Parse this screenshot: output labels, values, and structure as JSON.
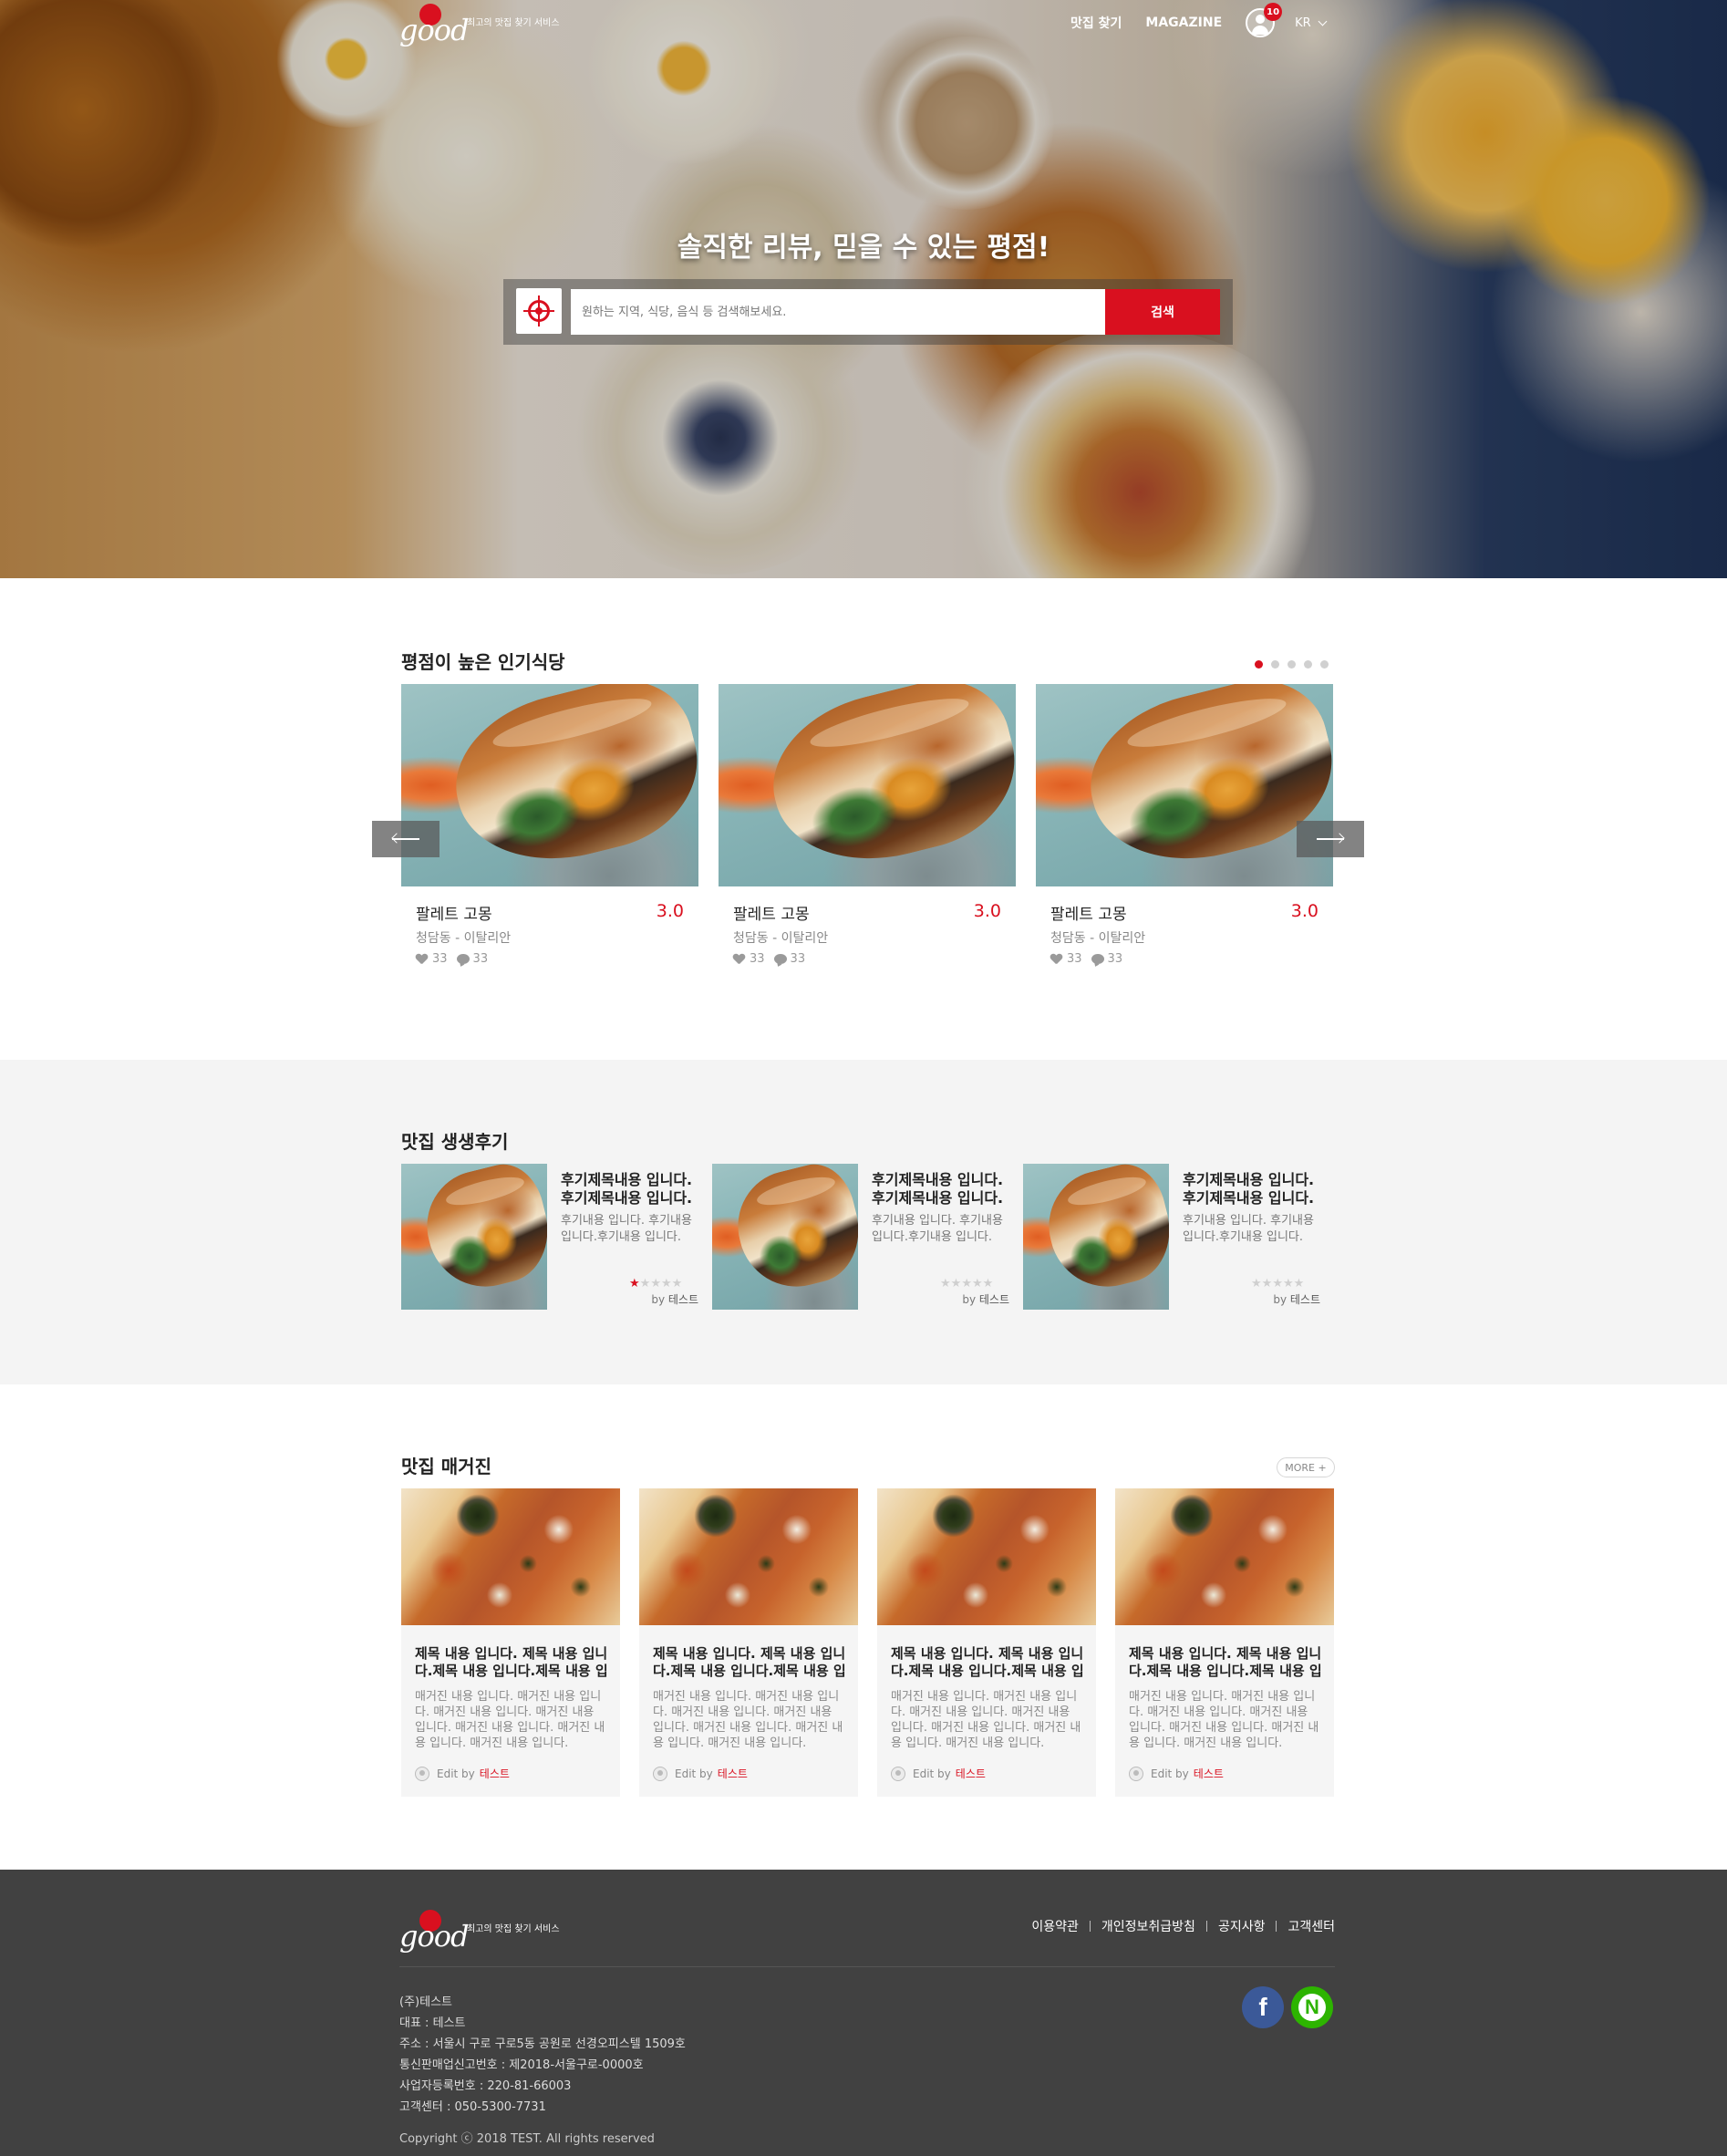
{
  "header": {
    "logo_text": "good",
    "tagline": "최고의 맛집 찾기 서비스",
    "nav": [
      "맛집 찾기",
      "MAGAZINE"
    ],
    "notification_count": "10",
    "lang": "KR"
  },
  "hero": {
    "title": "솔직한 리뷰, 믿을 수 있는 평점!",
    "search_placeholder": "원하는 지역, 식당, 음식 등 검색해보세요.",
    "search_button": "검색"
  },
  "popular": {
    "title": "평점이 높은 인기식당",
    "pager_total": 5,
    "pager_active": 1,
    "cards": [
      {
        "name": "팔레트 고몽",
        "score": "3.0",
        "meta": "청담동 - 이탈리안",
        "likes": "33",
        "comments": "33"
      },
      {
        "name": "팔레트 고몽",
        "score": "3.0",
        "meta": "청담동 - 이탈리안",
        "likes": "33",
        "comments": "33"
      },
      {
        "name": "팔레트 고몽",
        "score": "3.0",
        "meta": "청담동 - 이탈리안",
        "likes": "33",
        "comments": "33"
      }
    ]
  },
  "reviews": {
    "title": "맛집 생생후기",
    "items": [
      {
        "title": "후기제목내용 입니다. 후기제목내용 입니다.",
        "body": "후기내용 입니다. 후기내용 입니다.후기내용 입니다.",
        "rating": 1,
        "by": "by",
        "author": "테스트"
      },
      {
        "title": "후기제목내용 입니다. 후기제목내용 입니다.",
        "body": "후기내용 입니다. 후기내용 입니다.후기내용 입니다.",
        "rating": 0,
        "by": "by",
        "author": "테스트"
      },
      {
        "title": "후기제목내용 입니다. 후기제목내용 입니다.",
        "body": "후기내용 입니다. 후기내용 입니다.후기내용 입니다.",
        "rating": 0,
        "by": "by",
        "author": "테스트"
      }
    ]
  },
  "magazine": {
    "title": "맛집 매거진",
    "more": "MORE +",
    "items": [
      {
        "title": "제목 내용 입니다. 제목 내용 입니다.제목 내용 입니다.제목 내용 입니다.",
        "body": "매거진 내용 입니다. 매거진 내용 입니다. 매거진 내용 입니다. 매거진 내용 입니다. 매거진 내용 입니다. 매거진 내용 입니다. 매거진 내용 입니다.",
        "edit_by": "Edit by",
        "author": "테스트"
      },
      {
        "title": "제목 내용 입니다. 제목 내용 입니다.제목 내용 입니다.제목 내용 입니다.",
        "body": "매거진 내용 입니다. 매거진 내용 입니다. 매거진 내용 입니다. 매거진 내용 입니다. 매거진 내용 입니다. 매거진 내용 입니다. 매거진 내용 입니다.",
        "edit_by": "Edit by",
        "author": "테스트"
      },
      {
        "title": "제목 내용 입니다. 제목 내용 입니다.제목 내용 입니다.제목 내용 입니다.",
        "body": "매거진 내용 입니다. 매거진 내용 입니다. 매거진 내용 입니다. 매거진 내용 입니다. 매거진 내용 입니다. 매거진 내용 입니다. 매거진 내용 입니다.",
        "edit_by": "Edit by",
        "author": "테스트"
      },
      {
        "title": "제목 내용 입니다. 제목 내용 입니다.제목 내용 입니다.제목 내용 입니다.",
        "body": "매거진 내용 입니다. 매거진 내용 입니다. 매거진 내용 입니다. 매거진 내용 입니다. 매거진 내용 입니다. 매거진 내용 입니다. 매거진 내용 입니다.",
        "edit_by": "Edit by",
        "author": "테스트"
      }
    ]
  },
  "footer": {
    "tagline": "최고의 맛집 찾기 서비스",
    "links": [
      "이용약관",
      "개인정보취급방침",
      "공지사항",
      "고객센터"
    ],
    "info": [
      "(주)테스트",
      "대표 : 테스트",
      "주소 : 서울시 구로 구로5동 공원로 선경오피스텔 1509호",
      "통신판매업신고번호 : 제2018-서울구로-0000호",
      "사업자등록번호 : 220-81-66003",
      "고객센터 : 050-5300-7731"
    ],
    "copyright": "Copyright ⓒ 2018 TEST. All rights reserved",
    "social": [
      "f",
      "N"
    ]
  },
  "colors": {
    "accent": "#d9101f",
    "footer_bg": "#414141",
    "section_bg": "#f4f4f4"
  }
}
